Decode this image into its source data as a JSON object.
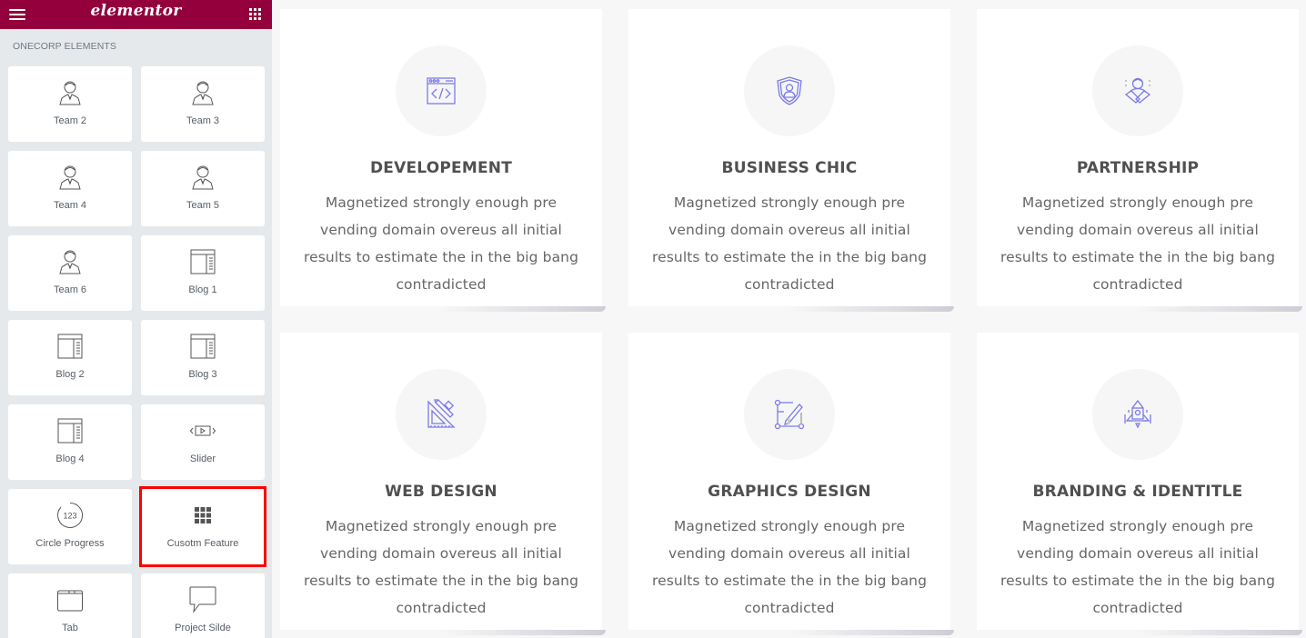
{
  "sidebar": {
    "brand": "elementor",
    "section_title": "ONECORP ELEMENTS",
    "elements": [
      {
        "label": "Team 2",
        "icon": "team-member-icon"
      },
      {
        "label": "Team 3",
        "icon": "team-member-icon"
      },
      {
        "label": "Team 4",
        "icon": "team-member-icon"
      },
      {
        "label": "Team 5",
        "icon": "team-member-icon"
      },
      {
        "label": "Team 6",
        "icon": "team-member-icon"
      },
      {
        "label": "Blog 1",
        "icon": "blog-layout-icon"
      },
      {
        "label": "Blog 2",
        "icon": "blog-layout-icon"
      },
      {
        "label": "Blog 3",
        "icon": "blog-layout-icon"
      },
      {
        "label": "Blog 4",
        "icon": "blog-layout-icon"
      },
      {
        "label": "Slider",
        "icon": "slider-icon"
      },
      {
        "label": "Circle Progress",
        "icon": "circle-progress-icon",
        "icon_text": "123"
      },
      {
        "label": "Cusotm Feature",
        "icon": "grid-feature-icon",
        "selected": true
      },
      {
        "label": "Tab",
        "icon": "tab-icon"
      },
      {
        "label": "Project Silde",
        "icon": "speech-bubble-icon"
      }
    ]
  },
  "colors": {
    "brand": "#93003c",
    "icon_accent": "#7b7be8",
    "highlight": "#ff0000"
  },
  "features": [
    {
      "title": "DEVELOPEMENT",
      "icon": "code-window-icon",
      "description": "Magnetized strongly enough pre vending domain overeus all initial results to estimate the in the big bang contradicted"
    },
    {
      "title": "BUSINESS CHIC",
      "icon": "shield-user-icon",
      "description": "Magnetized strongly enough pre vending domain overeus all initial results to estimate the in the big bang contradicted"
    },
    {
      "title": "PARTNERSHIP",
      "icon": "handshake-icon",
      "description": "Magnetized strongly enough pre vending domain overeus all initial results to estimate the in the big bang contradicted"
    },
    {
      "title": "WEB DESIGN",
      "icon": "ruler-pencil-icon",
      "description": "Magnetized strongly enough pre vending domain overeus all initial results to estimate the in the big bang contradicted"
    },
    {
      "title": "GRAPHICS DESIGN",
      "icon": "vector-edit-icon",
      "description": "Magnetized strongly enough pre vending domain overeus all initial results to estimate the in the big bang contradicted"
    },
    {
      "title": "BRANDING & IDENTITLE",
      "icon": "rocket-icon",
      "description": "Magnetized strongly enough pre vending domain overeus all initial results to estimate the in the big bang contradicted"
    }
  ]
}
